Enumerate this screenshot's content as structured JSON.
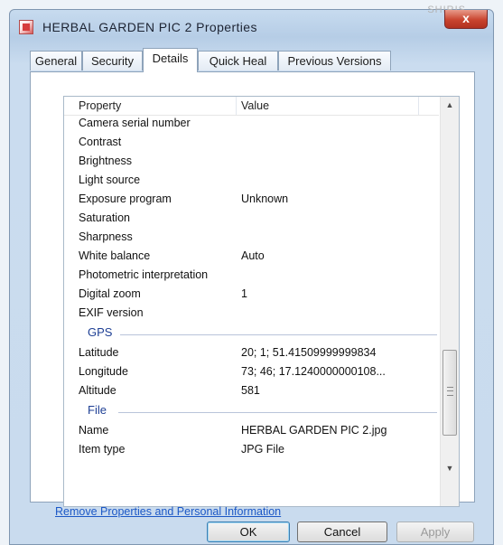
{
  "window": {
    "title": "HERBAL GARDEN PIC 2 Properties",
    "background_ghost_text": "SHIRIS",
    "close_label": "x"
  },
  "tabs": [
    {
      "label": "General"
    },
    {
      "label": "Security"
    },
    {
      "label": "Details",
      "active": true
    },
    {
      "label": "Quick Heal"
    },
    {
      "label": "Previous Versions"
    }
  ],
  "list": {
    "headers": {
      "property": "Property",
      "value": "Value"
    },
    "rows": [
      {
        "property": "Camera serial number",
        "value": ""
      },
      {
        "property": "Contrast",
        "value": ""
      },
      {
        "property": "Brightness",
        "value": ""
      },
      {
        "property": "Light source",
        "value": ""
      },
      {
        "property": "Exposure program",
        "value": "Unknown"
      },
      {
        "property": "Saturation",
        "value": ""
      },
      {
        "property": "Sharpness",
        "value": ""
      },
      {
        "property": "White balance",
        "value": "Auto"
      },
      {
        "property": "Photometric interpretation",
        "value": ""
      },
      {
        "property": "Digital zoom",
        "value": "1"
      },
      {
        "property": "EXIF version",
        "value": ""
      }
    ],
    "groups": {
      "gps": {
        "title": "GPS",
        "rows": [
          {
            "property": "Latitude",
            "value": "20; 1; 51.41509999999834"
          },
          {
            "property": "Longitude",
            "value": "73; 46; 17.1240000000108..."
          },
          {
            "property": "Altitude",
            "value": "581"
          }
        ]
      },
      "file": {
        "title": "File",
        "rows": [
          {
            "property": "Name",
            "value": "HERBAL GARDEN PIC 2.jpg"
          },
          {
            "property": "Item type",
            "value": "JPG File"
          }
        ]
      }
    }
  },
  "links": {
    "remove": "Remove Properties and Personal Information"
  },
  "buttons": {
    "ok": "OK",
    "cancel": "Cancel",
    "apply": "Apply"
  },
  "colors": {
    "group_heading": "#1e3f94",
    "link": "#1c58c6",
    "title_bar": "#b6cde6"
  }
}
